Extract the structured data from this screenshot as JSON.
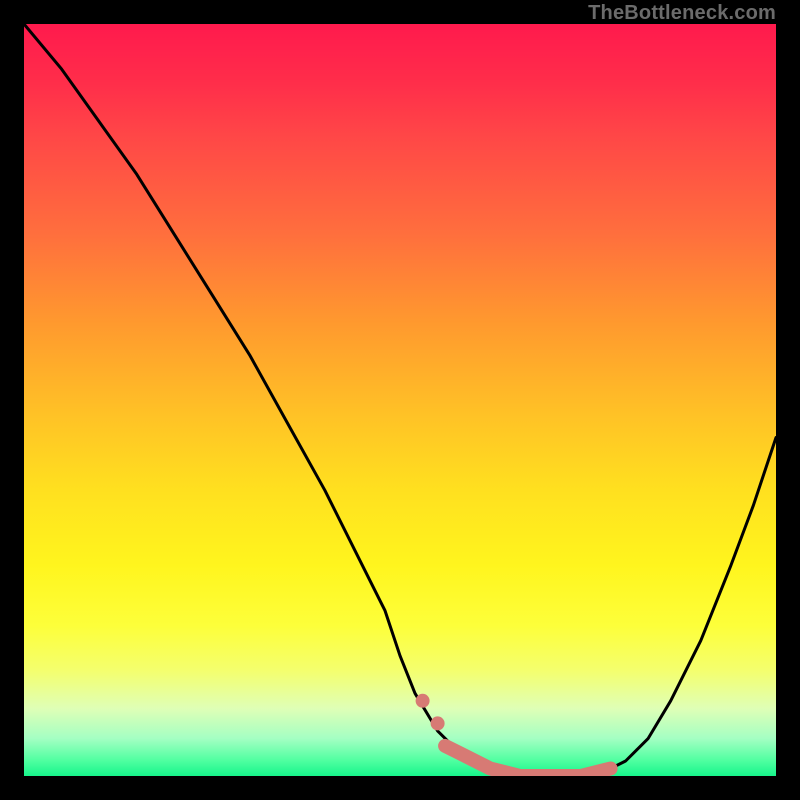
{
  "watermark": "TheBottleneck.com",
  "colors": {
    "background": "#000000",
    "curve": "#000000",
    "highlight": "#d77a74",
    "gradient_top": "#ff1a4d",
    "gradient_mid": "#ffe01f",
    "gradient_bottom": "#17f58b"
  },
  "chart_data": {
    "type": "line",
    "title": "",
    "xlabel": "",
    "ylabel": "",
    "xlim": [
      0,
      100
    ],
    "ylim": [
      0,
      100
    ],
    "grid": false,
    "legend": false,
    "series": [
      {
        "name": "bottleneck-curve",
        "x": [
          0,
          5,
          10,
          15,
          20,
          25,
          30,
          35,
          40,
          45,
          48,
          50,
          52,
          55,
          58,
          62,
          66,
          70,
          74,
          78,
          80,
          83,
          86,
          90,
          94,
          97,
          100
        ],
        "values": [
          100,
          94,
          87,
          80,
          72,
          64,
          56,
          47,
          38,
          28,
          22,
          16,
          11,
          6,
          3,
          1,
          0,
          0,
          0,
          1,
          2,
          5,
          10,
          18,
          28,
          36,
          45
        ]
      },
      {
        "name": "optimal-range-highlight",
        "x": [
          56,
          58,
          62,
          66,
          70,
          74,
          78
        ],
        "values": [
          4,
          3,
          1,
          0,
          0,
          0,
          1
        ]
      }
    ],
    "annotations": []
  }
}
